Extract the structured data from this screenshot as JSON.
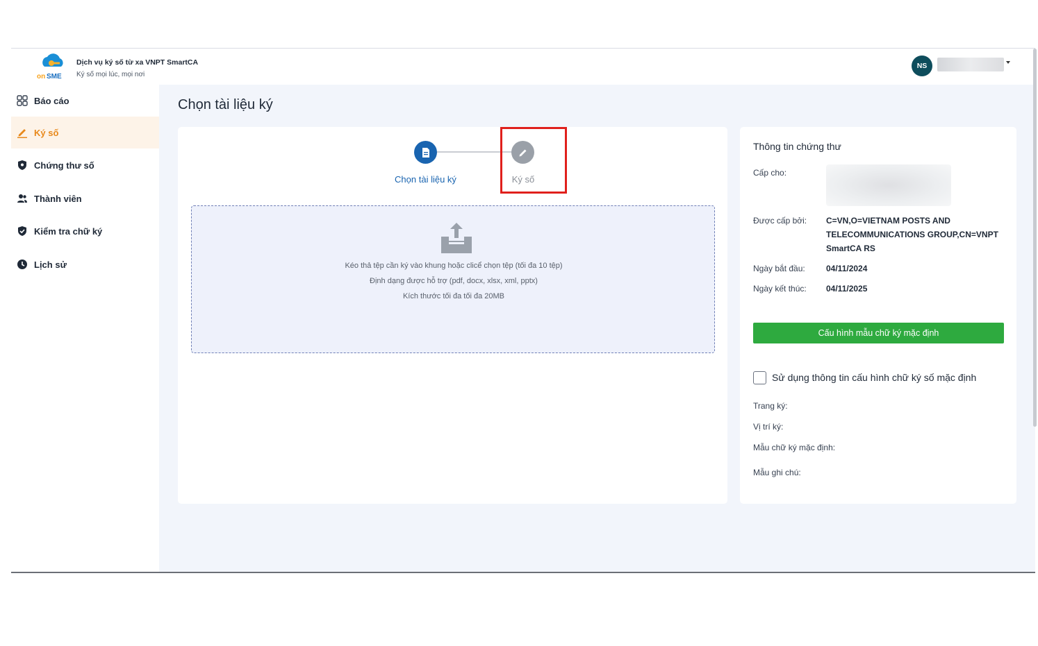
{
  "header": {
    "brand_logo_text": "on SME",
    "brand_title": "Dịch vụ ký số từ xa VNPT SmartCA",
    "brand_subtitle": "Ký số mọi lúc, mọi nơi",
    "user_initials": "NS"
  },
  "sidebar": {
    "items": [
      {
        "label": "Báo cáo",
        "icon": "grid-icon"
      },
      {
        "label": "Ký số",
        "icon": "pen-icon"
      },
      {
        "label": "Chứng thư số",
        "icon": "shield-icon"
      },
      {
        "label": "Thành viên",
        "icon": "users-icon"
      },
      {
        "label": "Kiểm tra chữ ký",
        "icon": "shield-check-icon"
      },
      {
        "label": "Lịch sử",
        "icon": "clock-icon"
      }
    ],
    "active_index": 1
  },
  "page": {
    "title": "Chọn tài liệu ký"
  },
  "steps": [
    {
      "label": "Chọn tài liệu ký",
      "state": "active"
    },
    {
      "label": "Ký số",
      "state": "inactive"
    }
  ],
  "dropzone": {
    "line1": "Kéo thả tệp cần ký vào khung hoặc clicể chọn tệp (tối đa 10 tệp)",
    "line2": "Định dạng được hỗ trợ (pdf, docx, xlsx, xml, pptx)",
    "line3": "Kích thước tối đa tối đa 20MB"
  },
  "certificate": {
    "title": "Thông tin chứng thư",
    "issued_to_label": "Cấp cho:",
    "issued_by_label": "Được cấp bởi:",
    "issued_by_lines": [
      "C=VN,O=VIETNAM POSTS AND",
      "TELECOMMUNICATIONS GROUP,CN=VNPT",
      "SmartCA RS"
    ],
    "start_label": "Ngày bắt đầu:",
    "start_value": "04/11/2024",
    "end_label": "Ngày kết thúc:",
    "end_value": "04/11/2025",
    "config_button": "Cấu hình mẫu chữ ký mặc định",
    "use_default_label": "Sử dụng thông tin cấu hình chữ ký số mặc định",
    "use_default_checked": false,
    "page_label": "Trang ký:",
    "position_label": "Vị trí ký:",
    "sig_template_label": "Mẫu chữ ký mặc định:",
    "note_template_label": "Mẫu ghi chú:"
  },
  "colors": {
    "primary": "#1964b0",
    "accent_orange": "#e8891c",
    "green": "#2eaa3f",
    "highlight_red": "#e0201c",
    "avatar": "#0e4d5c"
  }
}
